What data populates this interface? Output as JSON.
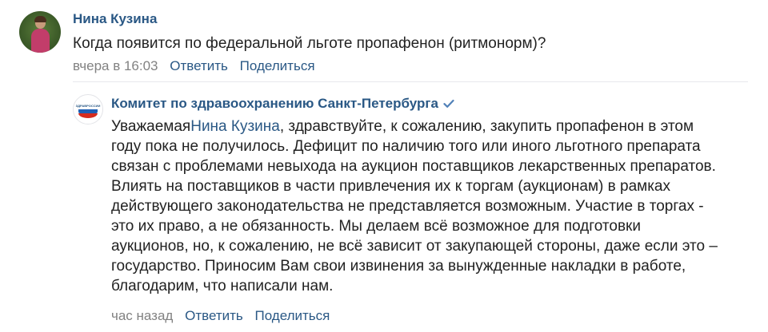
{
  "comments": [
    {
      "author": "Нина Кузина",
      "text": "Когда появится по федеральной льготе пропафенон (ритмонорм)?",
      "time": "вчера в 16:03",
      "reply_label": "Ответить",
      "share_label": "Поделиться"
    },
    {
      "author": "Комитет по здравоохранению Санкт-Петербурга",
      "verified": true,
      "avatar_logo_text": "ЗДРАВРОССИИ",
      "text_prefix": "Уважаемая",
      "mention": "Нина Кузина",
      "text_lines": [
        ", здравствуйте, к сожалению, закупить пропафенон в этом",
        "году пока не получилось. Дефицит по наличию того или иного льготного препарата",
        "связан с проблемами невыхода на аукцион поставщиков лекарственных препаратов.",
        "Влиять на поставщиков в части привлечения их к торгам (аукционам) в рамках",
        "действующего законодательства не представляется возможным. Участие в торгах -",
        "это их право, а не обязанность. Мы делаем всё возможное для подготовки",
        "аукционов, но, к сожалению, не всё зависит от закупающей стороны, даже если это –",
        "государство. Приносим Вам свои извинения за вынужденные накладки в работе,",
        "благодарим, что написали нам."
      ],
      "time": "час назад",
      "reply_label": "Ответить",
      "share_label": "Поделиться"
    }
  ],
  "colors": {
    "link": "#2a5885",
    "meta": "#828282",
    "verified": "#5181b8"
  }
}
